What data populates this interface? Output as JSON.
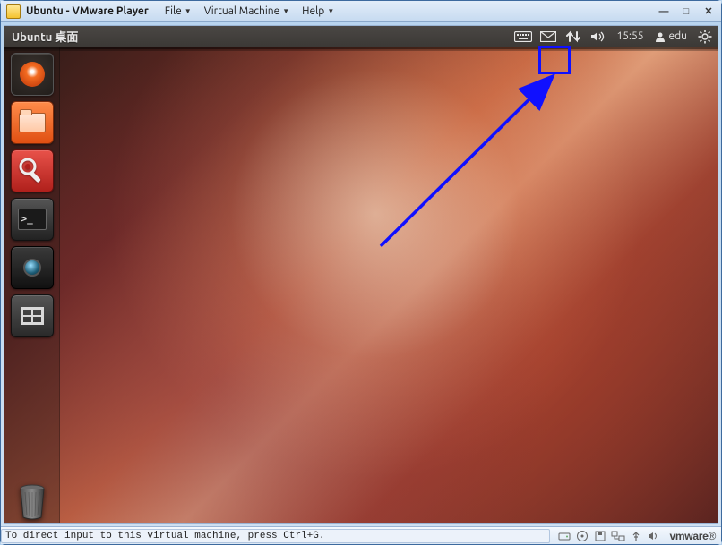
{
  "vmware": {
    "title": "Ubuntu - VMware Player",
    "menu": {
      "file": "File",
      "vm": "Virtual Machine",
      "help": "Help"
    },
    "brand": "vmware"
  },
  "ubuntu": {
    "menubar_title": "Ubuntu 桌面",
    "time": "15:55",
    "user": "edu"
  },
  "launcher": {
    "terminal_prompt": ">_"
  },
  "status": {
    "message": "To direct input to this virtual machine, press Ctrl+G."
  }
}
